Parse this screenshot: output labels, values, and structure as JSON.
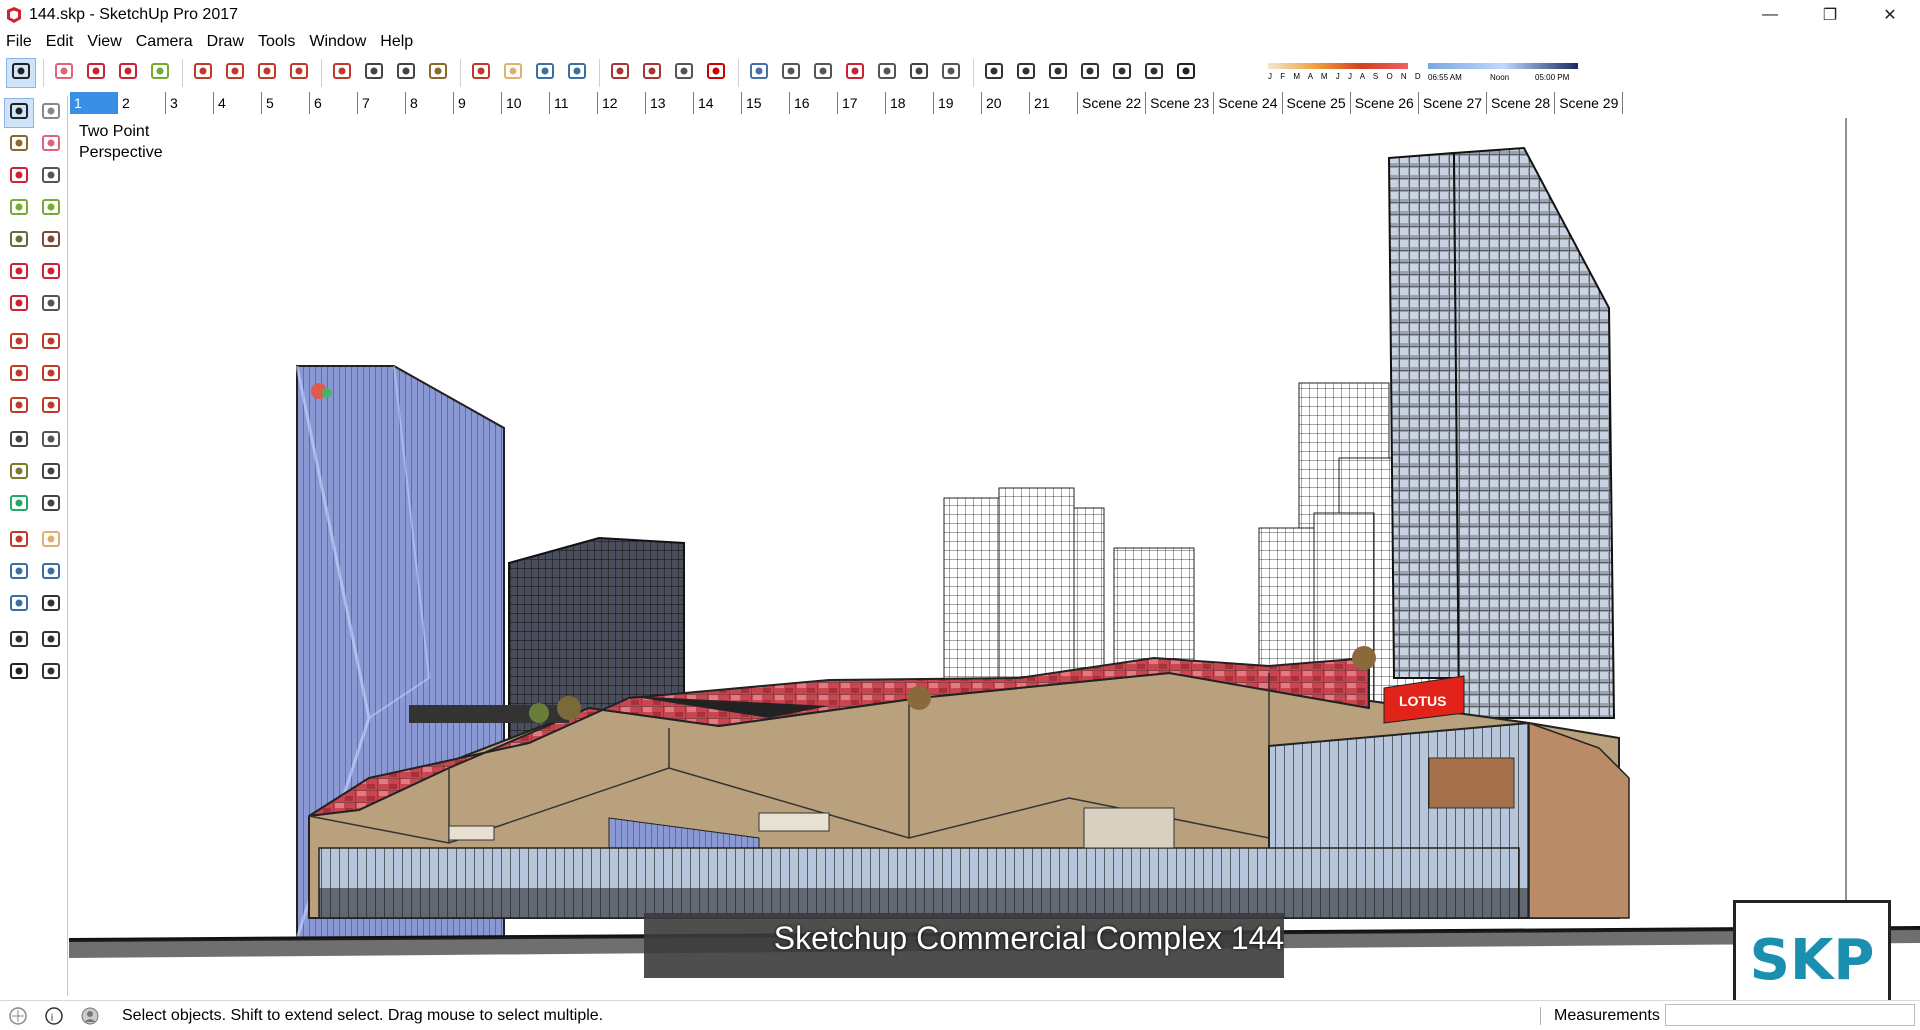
{
  "window": {
    "title": "144.skp - SketchUp Pro 2017",
    "minimize_label": "—",
    "maximize_label": "❐",
    "close_label": "✕"
  },
  "menu": [
    "File",
    "Edit",
    "View",
    "Camera",
    "Draw",
    "Tools",
    "Window",
    "Help"
  ],
  "toolbar": {
    "icons": [
      "select-icon",
      "eraser-icon",
      "line-pencil-icon",
      "arc-icon",
      "rectangle-icon",
      "push-pull-icon",
      "follow-me-icon",
      "move-icon",
      "rotate-icon",
      "scale-icon",
      "tape-measure-icon",
      "text-icon",
      "paint-bucket-icon",
      "orbit-icon",
      "pan-icon",
      "zoom-icon",
      "zoom-extents-icon",
      "warehouse-icon",
      "extension-warehouse-icon",
      "share-model-icon",
      "ruby-icon",
      "xray-icon",
      "back-edges-icon",
      "wireframe-icon",
      "hidden-line-icon",
      "shaded-icon",
      "shaded-textures-icon",
      "monochrome-icon",
      "iso-view-icon",
      "top-view-icon",
      "front-view-icon",
      "right-view-icon",
      "back-view-icon",
      "left-view-icon",
      "shadows-toggle-icon"
    ],
    "active_index": 0,
    "shadow_months": "J F M A M J J A S O N D",
    "shadow_time_start": "06:55 AM",
    "shadow_time_mid": "Noon",
    "shadow_time_end": "05:00 PM"
  },
  "scenes": {
    "active_index": 0,
    "tabs": [
      "1",
      "2",
      "3",
      "4",
      "5",
      "6",
      "7",
      "8",
      "9",
      "10",
      "11",
      "12",
      "13",
      "14",
      "15",
      "16",
      "17",
      "18",
      "19",
      "20",
      "21",
      "Scene 22",
      "Scene 23",
      "Scene 24",
      "Scene 25",
      "Scene 26",
      "Scene 27",
      "Scene 28",
      "Scene 29"
    ]
  },
  "left_tools": [
    [
      "select-icon",
      "component-icon"
    ],
    [
      "paint-bucket-icon",
      "eraser-icon"
    ],
    [
      "line-pencil-icon",
      "freehand-icon"
    ],
    [
      "rectangle-icon",
      "rotated-rectangle-icon"
    ],
    [
      "circle-icon",
      "polygon-icon"
    ],
    [
      "arc-icon",
      "two-point-arc-icon"
    ],
    [
      "three-point-arc-icon",
      "pie-icon"
    ],
    [
      "move-icon",
      "push-pull-icon"
    ],
    [
      "rotate-icon",
      "follow-me-icon"
    ],
    [
      "scale-icon",
      "offset-icon"
    ],
    [
      "tape-measure-icon",
      "dimension-icon"
    ],
    [
      "protractor-icon",
      "text-icon"
    ],
    [
      "axes-icon",
      "3d-text-icon"
    ],
    [
      "orbit-icon",
      "pan-icon"
    ],
    [
      "zoom-icon",
      "zoom-window-icon"
    ],
    [
      "zoom-extents-icon",
      "previous-view-icon"
    ],
    [
      "position-camera-icon",
      "look-around-icon"
    ],
    [
      "walk-icon",
      "section-plane-icon"
    ]
  ],
  "viewport": {
    "camera_line1": "Two Point",
    "camera_line2": "Perspective",
    "caption": "Sketchup Commercial Complex 144",
    "logo_text": "SKP",
    "sign_text": "LOTUS"
  },
  "status": {
    "message": "Select objects. Shift to extend select. Drag mouse to select multiple.",
    "measurements_label": "Measurements",
    "measurements_value": ""
  },
  "colors": {
    "active_tab": "#3b8ee6",
    "roof_red": "#c8464f",
    "facade_tan": "#b9a17d",
    "glass_blue": "#7f8fcf"
  }
}
